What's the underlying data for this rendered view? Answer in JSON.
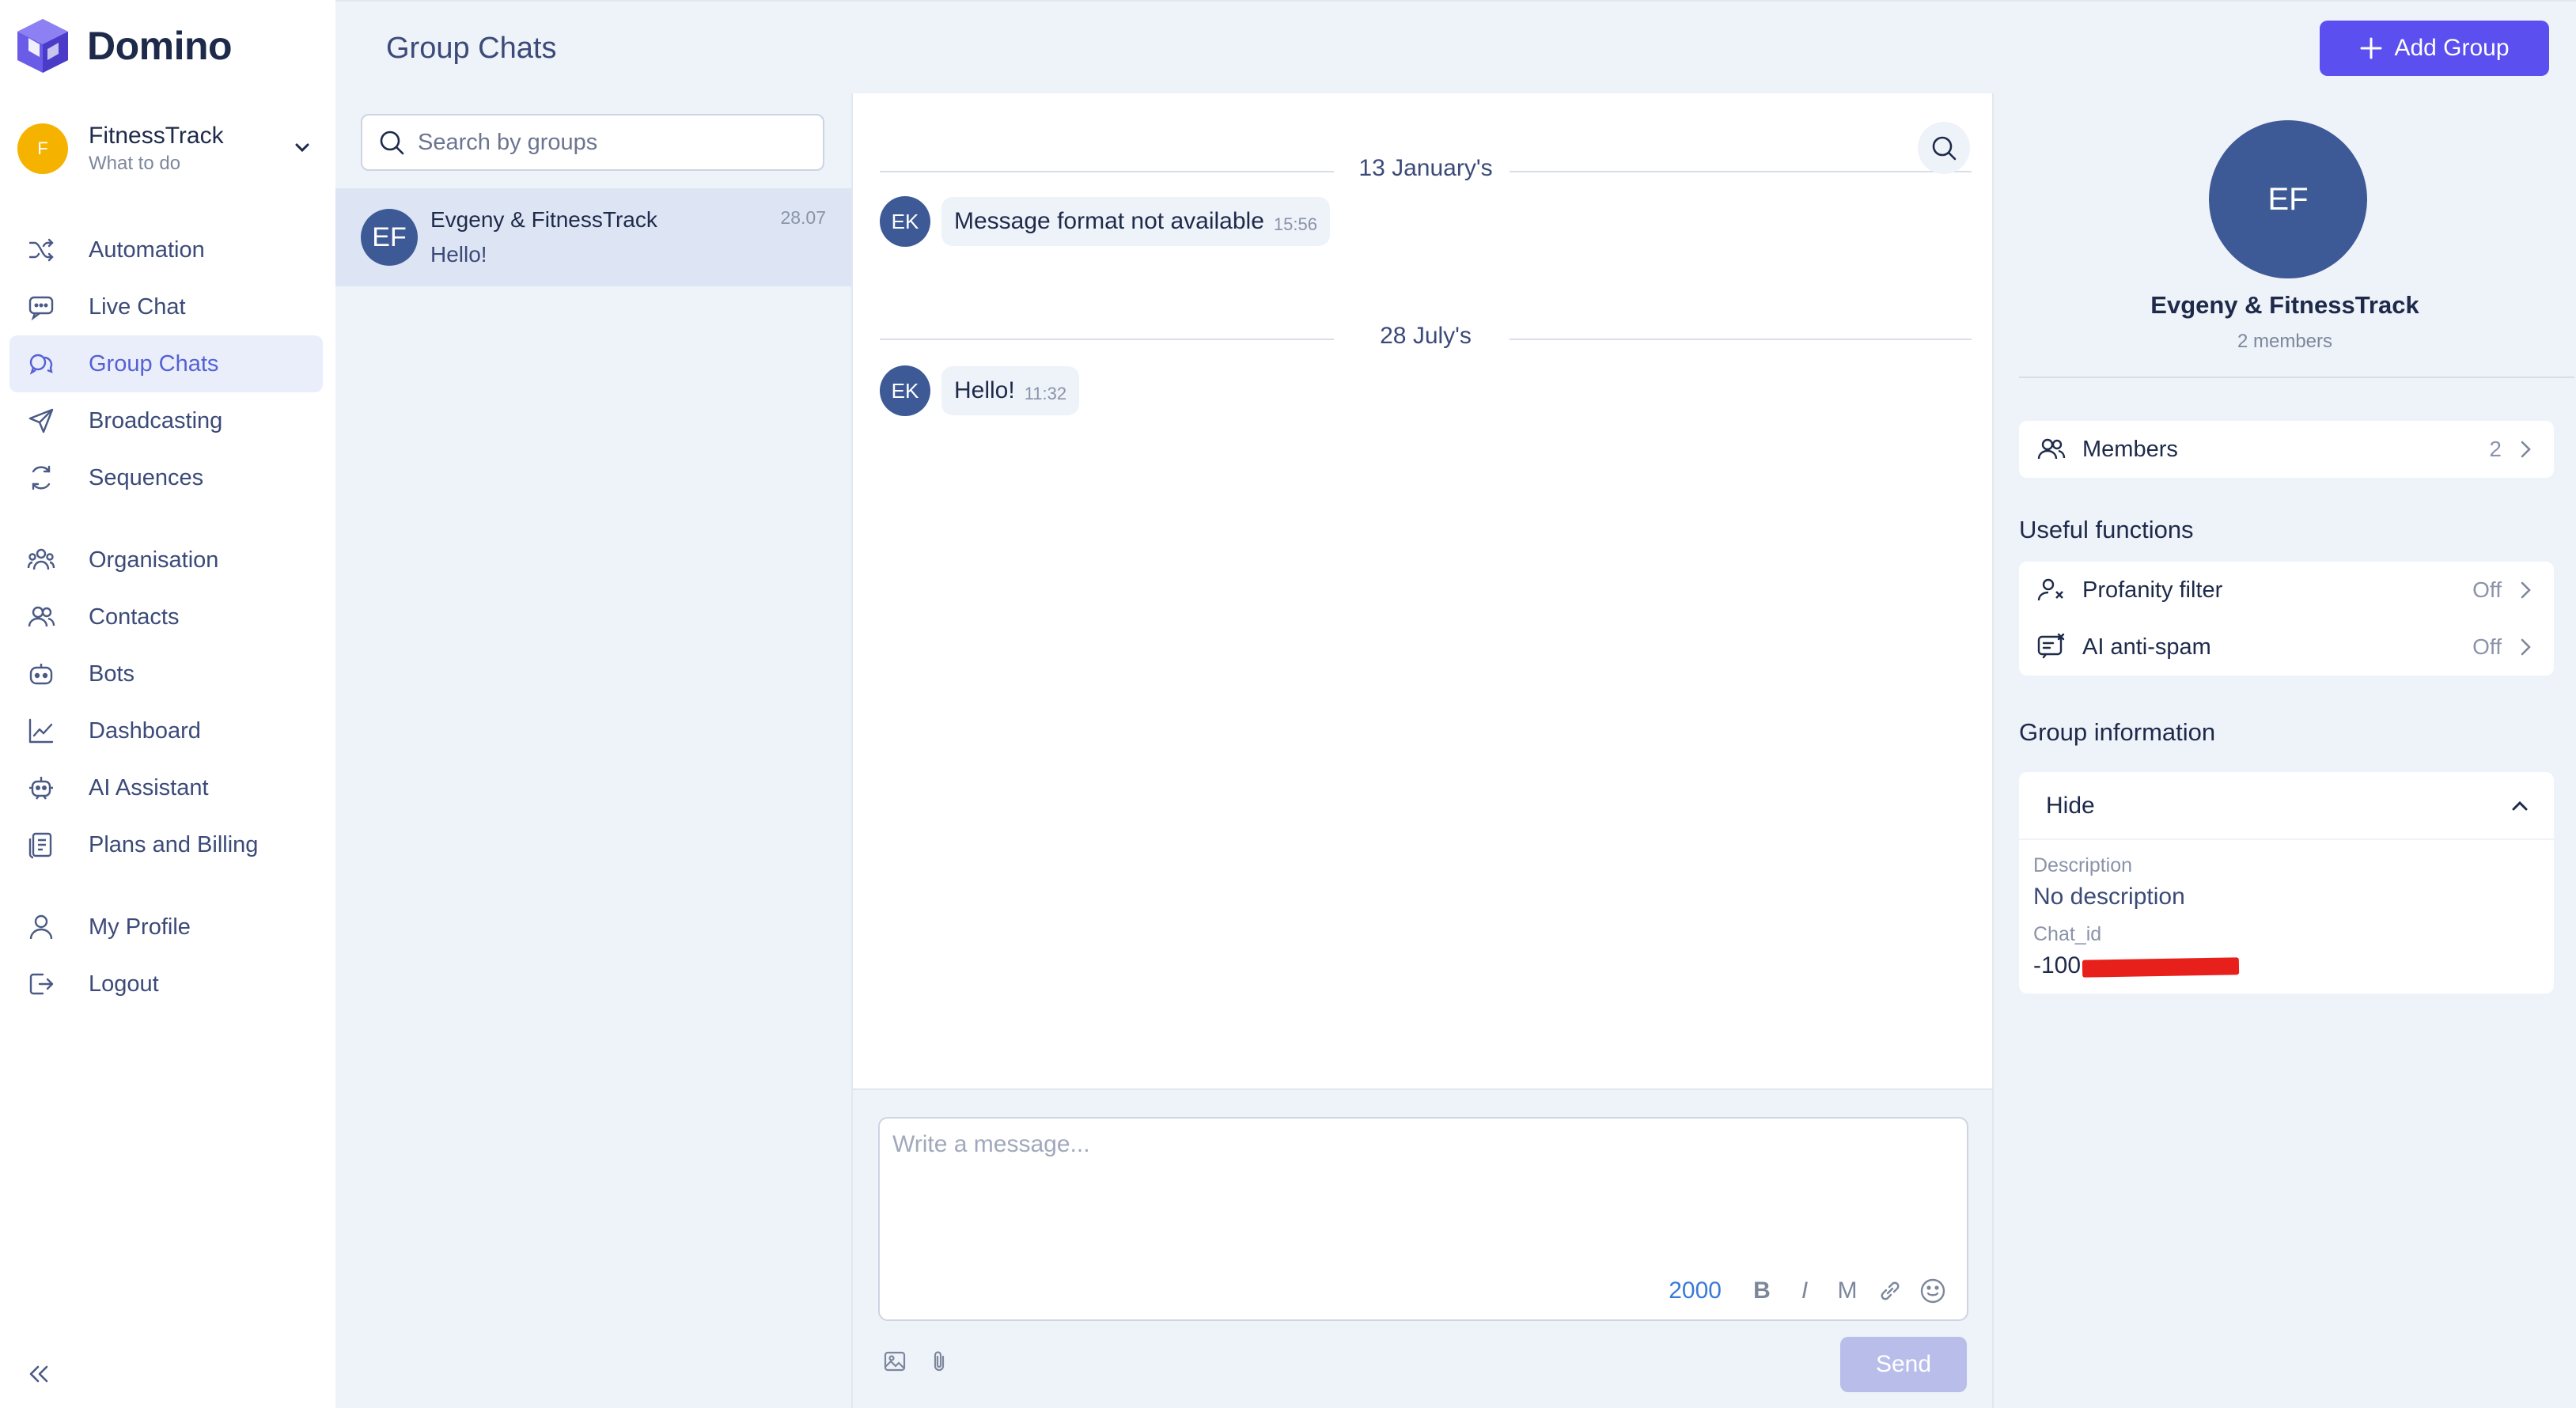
{
  "app": {
    "name": "Domino"
  },
  "account": {
    "initial": "F",
    "name": "FitnessTrack",
    "subtitle": "What to do"
  },
  "nav": {
    "items": [
      {
        "id": "automation",
        "label": "Automation",
        "icon": "shuffle-icon"
      },
      {
        "id": "live-chat",
        "label": "Live Chat",
        "icon": "chat-bubble-icon"
      },
      {
        "id": "group-chats",
        "label": "Group Chats",
        "icon": "group-chat-icon",
        "active": true
      },
      {
        "id": "broadcasting",
        "label": "Broadcasting",
        "icon": "send-icon"
      },
      {
        "id": "sequences",
        "label": "Sequences",
        "icon": "loop-icon"
      },
      {
        "id": "organisation",
        "label": "Organisation",
        "icon": "organisation-icon"
      },
      {
        "id": "contacts",
        "label": "Contacts",
        "icon": "contacts-icon"
      },
      {
        "id": "bots",
        "label": "Bots",
        "icon": "bot-icon"
      },
      {
        "id": "dashboard",
        "label": "Dashboard",
        "icon": "chart-icon"
      },
      {
        "id": "ai-assistant",
        "label": "AI Assistant",
        "icon": "assistant-icon"
      },
      {
        "id": "plans-billing",
        "label": "Plans and Billing",
        "icon": "billing-icon"
      },
      {
        "id": "my-profile",
        "label": "My Profile",
        "icon": "user-icon"
      },
      {
        "id": "logout",
        "label": "Logout",
        "icon": "logout-icon"
      }
    ]
  },
  "header": {
    "title": "Group Chats",
    "add_button": "Add Group"
  },
  "groups": {
    "search_placeholder": "Search by groups",
    "items": [
      {
        "initials": "EF",
        "name": "Evgeny & FitnessTrack",
        "last_message": "Hello!",
        "date": "28.07"
      }
    ]
  },
  "chat": {
    "days": [
      {
        "label": "13 January's",
        "messages": [
          {
            "initials": "EK",
            "text": "Message format not available",
            "time": "15:56"
          }
        ]
      },
      {
        "label": "28 July's",
        "messages": [
          {
            "initials": "EK",
            "text": "Hello!",
            "time": "11:32"
          }
        ]
      }
    ],
    "composer": {
      "placeholder": "Write a message...",
      "char_limit": "2000",
      "format_bold": "B",
      "format_italic": "I",
      "format_mono": "M",
      "send_label": "Send"
    }
  },
  "group_info": {
    "initials": "EF",
    "name": "Evgeny & FitnessTrack",
    "members_text": "2 members",
    "members_label": "Members",
    "members_count": "2",
    "useful_title": "Useful functions",
    "functions": [
      {
        "label": "Profanity filter",
        "value": "Off",
        "icon": "profanity-filter-icon"
      },
      {
        "label": "AI anti-spam",
        "value": "Off",
        "icon": "anti-spam-icon"
      }
    ],
    "info_title": "Group information",
    "toggle_label": "Hide",
    "description_label": "Description",
    "description_value": "No description",
    "chat_id_label": "Chat_id",
    "chat_id_visible": "-100"
  },
  "colors": {
    "accent": "#5b4ff0",
    "active_nav": "#5561d4",
    "avatar": "#3d5a96",
    "account_avatar": "#f5b300",
    "redaction": "#e8201b"
  }
}
